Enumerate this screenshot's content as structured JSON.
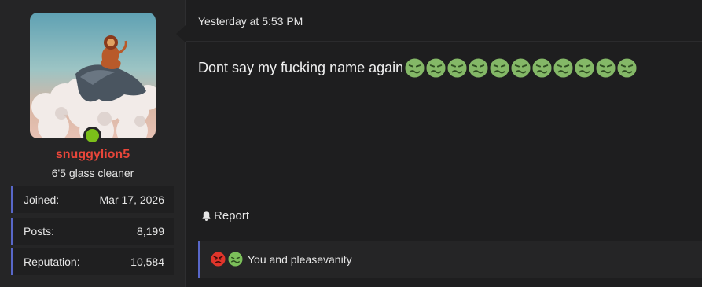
{
  "post": {
    "user": {
      "username": "snuggylion5",
      "title": "6'5 glass cleaner",
      "online_color": "#7bbf1a",
      "username_color": "#e8463a",
      "stats": [
        {
          "label": "Joined:",
          "value": "Mar 17, 2026"
        },
        {
          "label": "Posts:",
          "value": "8,199"
        },
        {
          "label": "Reputation:",
          "value": "10,584"
        }
      ]
    },
    "timestamp": "Yesterday at 5:53 PM",
    "message": {
      "text": "Dont say my fucking name again",
      "emoji": "nauseated-face",
      "emoji_count": 11
    },
    "actions": {
      "report_label": "Report",
      "report_icon": "bell-icon"
    },
    "reactions": {
      "icons": [
        "angry-face",
        "nauseated-face"
      ],
      "text": "You and pleasevanity"
    }
  }
}
